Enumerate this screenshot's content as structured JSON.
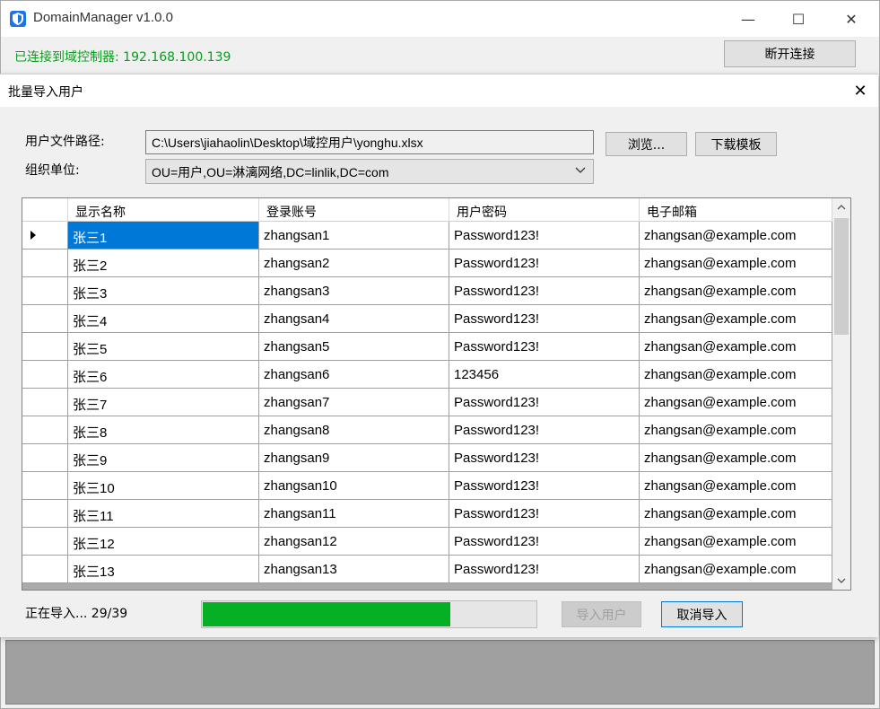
{
  "app": {
    "title": "DomainManager v1.0.0",
    "connection_status": "已连接到域控制器: 192.168.100.139",
    "disconnect_label": "断开连接",
    "minimize": "—",
    "maximize": "☐",
    "close": "✕"
  },
  "dialog": {
    "title": "批量导入用户",
    "close": "✕",
    "file_path_label": "用户文件路径:",
    "file_path_value": "C:\\Users\\jiahaolin\\Desktop\\域控用户\\yonghu.xlsx",
    "browse_label": "浏览...",
    "download_template_label": "下载模板",
    "ou_label": "组织单位:",
    "ou_value": "OU=用户,OU=淋漓网络,DC=linlik,DC=com",
    "progress_text": "正在导入... 29/39",
    "progress_current": 29,
    "progress_total": 39,
    "import_label": "导入用户",
    "cancel_label": "取消导入"
  },
  "grid": {
    "columns": [
      "显示名称",
      "登录账号",
      "用户密码",
      "电子邮箱"
    ],
    "rows": [
      [
        "张三1",
        "zhangsan1",
        "Password123!",
        "zhangsan@example.com"
      ],
      [
        "张三2",
        "zhangsan2",
        "Password123!",
        "zhangsan@example.com"
      ],
      [
        "张三3",
        "zhangsan3",
        "Password123!",
        "zhangsan@example.com"
      ],
      [
        "张三4",
        "zhangsan4",
        "Password123!",
        "zhangsan@example.com"
      ],
      [
        "张三5",
        "zhangsan5",
        "Password123!",
        "zhangsan@example.com"
      ],
      [
        "张三6",
        "zhangsan6",
        "123456",
        "zhangsan@example.com"
      ],
      [
        "张三7",
        "zhangsan7",
        "Password123!",
        "zhangsan@example.com"
      ],
      [
        "张三8",
        "zhangsan8",
        "Password123!",
        "zhangsan@example.com"
      ],
      [
        "张三9",
        "zhangsan9",
        "Password123!",
        "zhangsan@example.com"
      ],
      [
        "张三10",
        "zhangsan10",
        "Password123!",
        "zhangsan@example.com"
      ],
      [
        "张三11",
        "zhangsan11",
        "Password123!",
        "zhangsan@example.com"
      ],
      [
        "张三12",
        "zhangsan12",
        "Password123!",
        "zhangsan@example.com"
      ],
      [
        "张三13",
        "zhangsan13",
        "Password123!",
        "zhangsan@example.com"
      ]
    ]
  },
  "colors": {
    "connected": "#0a9e1e",
    "progress": "#06b025",
    "selection": "#0078d7"
  }
}
